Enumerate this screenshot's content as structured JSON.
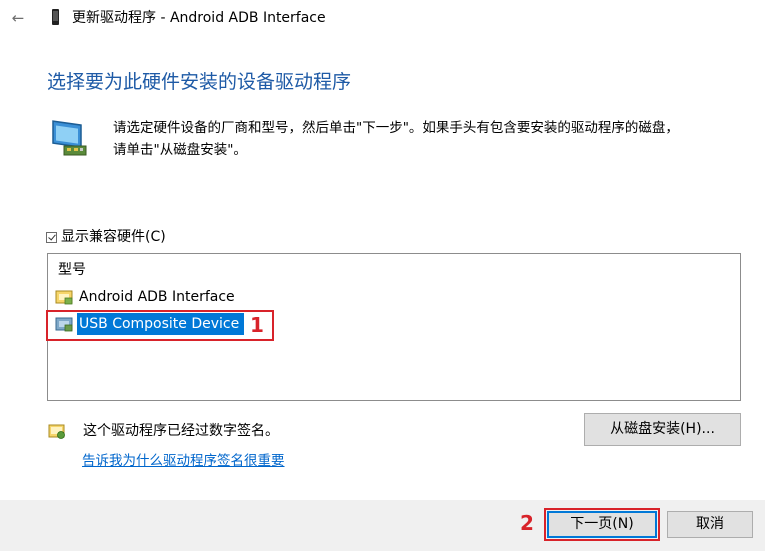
{
  "titlebar": {
    "back_glyph": "←",
    "device_icon": "phone-icon",
    "title": "更新驱动程序 - Android ADB Interface"
  },
  "heading": "选择要为此硬件安装的设备驱动程序",
  "instruction": {
    "icon": "hardware-monitor-icon",
    "line1": "请选定硬件设备的厂商和型号，然后单击\"下一步\"。如果手头有包含要安装的驱动程序的磁盘，",
    "line2": "请单击\"从磁盘安装\"。"
  },
  "compat_checkbox": {
    "label": "显示兼容硬件(C)",
    "checked": true
  },
  "model_list": {
    "header": "型号",
    "items": [
      {
        "label": "Android ADB Interface",
        "icon": "driver-icon",
        "selected": false
      },
      {
        "label": "USB Composite Device",
        "icon": "driver-icon",
        "selected": true
      }
    ]
  },
  "annotations": {
    "step1": "1",
    "step2": "2",
    "color": "#d8232a"
  },
  "signed": {
    "icon": "signed-driver-icon",
    "text": "这个驱动程序已经过数字签名。",
    "link": "告诉我为什么驱动程序签名很重要"
  },
  "buttons": {
    "have_disk": "从磁盘安装(H)...",
    "next": "下一页(N)",
    "cancel": "取消"
  },
  "colors": {
    "heading": "#1e5aa6",
    "selection": "#0078d7",
    "link": "#0066cc",
    "footer": "#f0f0f0"
  }
}
